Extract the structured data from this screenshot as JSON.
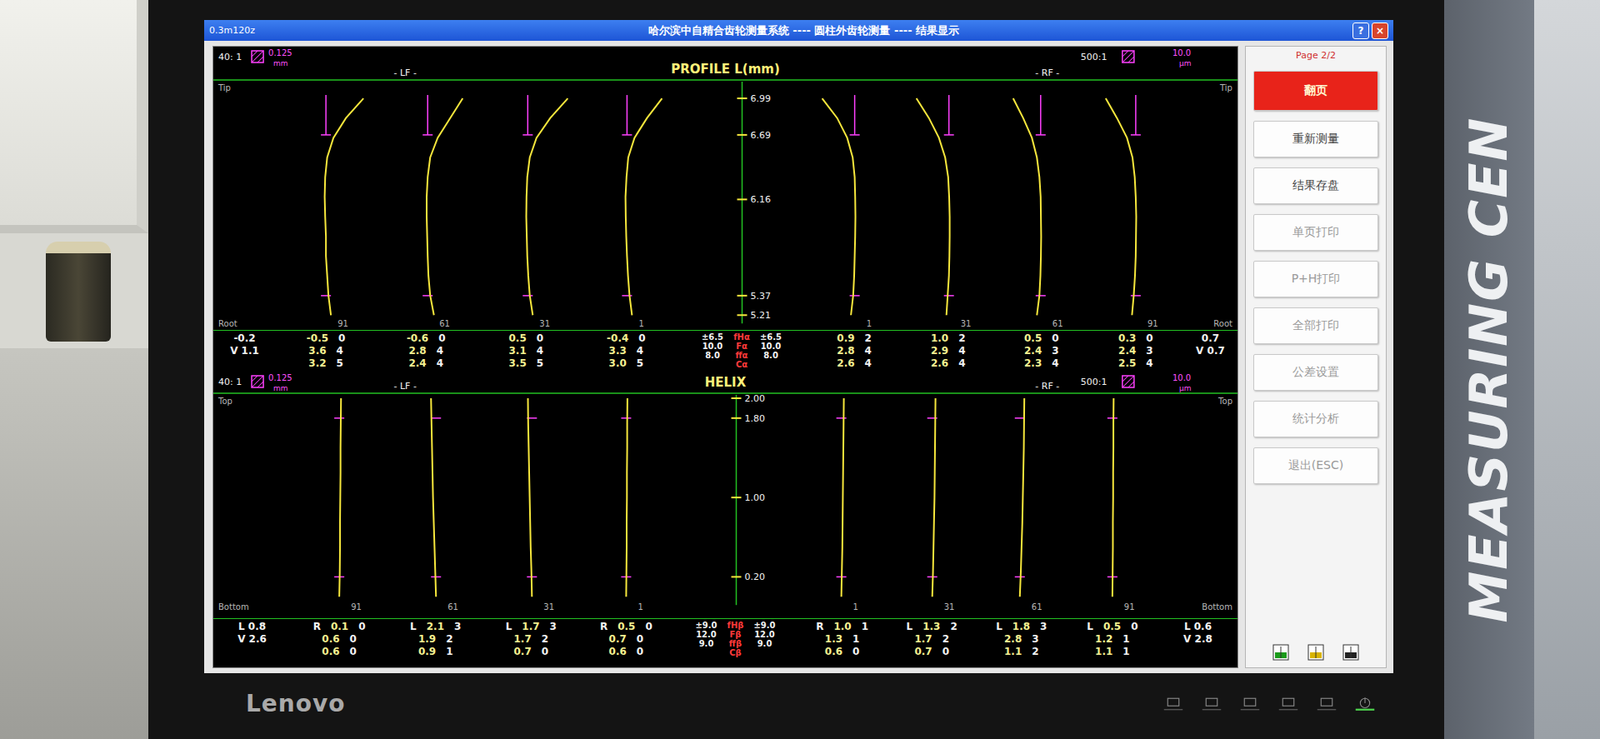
{
  "window": {
    "caption": "0.3m120z",
    "title": "哈尔滨中自精合齿轮测量系统 ---- 圆柱外齿轮测量 ---- 结果显示",
    "buttons": [
      "?",
      "×"
    ]
  },
  "panels": [
    {
      "kind": "profile",
      "scaleLeft": {
        "ratio": "40: 1",
        "value": "0.125",
        "unit": "mm"
      },
      "leftFlank": "- LF -",
      "title": "PROFILE L(mm)",
      "rightFlank": "- RF -",
      "scaleRight": {
        "ratio": "500:1",
        "value": "10.0",
        "unit": "µm"
      },
      "top": {
        "left": "Tip",
        "right": "Tip"
      },
      "bottom": {
        "left": "Root",
        "right": "Root"
      },
      "axis": {
        "min": 5.21,
        "max": 6.99,
        "ticks": [
          "6.99",
          "6.69",
          "6.16",
          "5.37",
          "5.21"
        ]
      },
      "evaluation": {
        "from": 5.37,
        "to": 6.69
      },
      "summaryLeft": [
        "-0.2",
        "V 1.1"
      ],
      "summaryRight": [
        "0.7",
        "V 0.7"
      ],
      "legend": [
        {
          "tolLeft": "±6.5",
          "label": "fHα",
          "tolRight": "±6.5"
        },
        {
          "tolLeft": "10.0",
          "label": "Fα",
          "tolRight": "10.0"
        },
        {
          "tolLeft": "8.0",
          "label": "ffα",
          "tolRight": "8.0"
        },
        {
          "label": "Cα"
        }
      ],
      "left": [
        {
          "tooth": "91",
          "values": [
            2,
            1,
            0.5,
            0,
            0,
            -0.3,
            -0.5,
            -0.3,
            0.5,
            3,
            8,
            15
          ],
          "rows": [
            {
              "value": "-0.5",
              "grade": "0"
            },
            {
              "value": "3.6",
              "grade": "4"
            },
            {
              "value": "3.2",
              "grade": "5"
            }
          ]
        },
        {
          "tooth": "61",
          "values": [
            2.5,
            1,
            0.3,
            0,
            -0.2,
            -0.4,
            -0.4,
            0,
            1,
            4,
            9,
            14
          ],
          "rows": [
            {
              "value": "-0.6",
              "grade": "0"
            },
            {
              "value": "2.8",
              "grade": "4"
            },
            {
              "value": "2.4",
              "grade": "4"
            }
          ]
        },
        {
          "tooth": "31",
          "values": [
            2,
            0.8,
            0.2,
            -0.2,
            -0.4,
            -0.6,
            -0.5,
            -0.2,
            0.8,
            3.5,
            9,
            16
          ],
          "rows": [
            {
              "value": "0.5",
              "grade": "0"
            },
            {
              "value": "3.1",
              "grade": "4"
            },
            {
              "value": "3.5",
              "grade": "5"
            }
          ]
        },
        {
          "tooth": "1",
          "values": [
            2,
            1,
            0.4,
            0,
            -0.3,
            -0.5,
            -0.6,
            -0.2,
            0.5,
            3,
            8,
            14
          ],
          "rows": [
            {
              "value": "-0.4",
              "grade": "0"
            },
            {
              "value": "3.3",
              "grade": "4"
            },
            {
              "value": "3.0",
              "grade": "5"
            }
          ]
        }
      ],
      "right": [
        {
          "tooth": "1",
          "values": [
            1.5,
            0.6,
            0.2,
            0,
            -0.2,
            -0.3,
            -0.2,
            0,
            0.8,
            3,
            7,
            13
          ],
          "rows": [
            {
              "value": "0.9",
              "grade": "2"
            },
            {
              "value": "2.8",
              "grade": "4"
            },
            {
              "value": "2.6",
              "grade": "4"
            }
          ]
        },
        {
          "tooth": "31",
          "values": [
            1,
            0.5,
            0,
            -0.2,
            -0.3,
            -0.3,
            -0.1,
            0.3,
            1.5,
            4,
            8,
            13
          ],
          "rows": [
            {
              "value": "1.0",
              "grade": "2"
            },
            {
              "value": "2.9",
              "grade": "4"
            },
            {
              "value": "2.6",
              "grade": "4"
            }
          ]
        },
        {
          "tooth": "61",
          "values": [
            1.5,
            0.5,
            0.1,
            -0.1,
            -0.2,
            -0.1,
            0,
            0.5,
            1.5,
            3.5,
            7,
            11
          ],
          "rows": [
            {
              "value": "0.5",
              "grade": "0"
            },
            {
              "value": "2.4",
              "grade": "3"
            },
            {
              "value": "2.3",
              "grade": "4"
            }
          ]
        },
        {
          "tooth": "91",
          "values": [
            1.5,
            0.8,
            0.3,
            0,
            -0.1,
            -0.2,
            0,
            0.4,
            1.3,
            3.5,
            7.5,
            12
          ],
          "rows": [
            {
              "value": "0.3",
              "grade": "0"
            },
            {
              "value": "2.4",
              "grade": "3"
            },
            {
              "value": "2.5",
              "grade": "4"
            }
          ]
        }
      ]
    },
    {
      "kind": "helix",
      "scaleLeft": {
        "ratio": "40: 1",
        "value": "0.125",
        "unit": "mm"
      },
      "leftFlank": "- LF -",
      "title": "HELIX",
      "rightFlank": "- RF -",
      "scaleRight": {
        "ratio": "500:1",
        "value": "10.0",
        "unit": "µm"
      },
      "top": {
        "left": "Top",
        "right": "Top"
      },
      "bottom": {
        "left": "Bottom",
        "right": "Bottom"
      },
      "axis": {
        "min": 0,
        "max": 2.0,
        "ticks": [
          "2.00",
          "1.80",
          "1.00",
          "0.20"
        ]
      },
      "evaluation": {
        "from": 0.2,
        "to": 1.8
      },
      "summaryLeft": [
        "L 0.8",
        "V 2.6"
      ],
      "summaryRight": [
        "L 0.6",
        "V 2.8"
      ],
      "legend": [
        {
          "tolLeft": "±9.0",
          "label": "fHβ",
          "tolRight": "±9.0"
        },
        {
          "tolLeft": "12.0",
          "label": "Fβ",
          "tolRight": "12.0"
        },
        {
          "tolLeft": "9.0",
          "label": "ffβ",
          "tolRight": "9.0"
        },
        {
          "label": "Cβ"
        }
      ],
      "left": [
        {
          "tooth": "91",
          "values": [
            0,
            0.2,
            0.3,
            0.3,
            0.4,
            0.5,
            0.5,
            0.6,
            0.7
          ],
          "rows": [
            {
              "dir": "R",
              "value": "0.1",
              "grade": "0"
            },
            {
              "value": "0.6",
              "grade": "0"
            },
            {
              "value": "0.6",
              "grade": "0"
            }
          ]
        },
        {
          "tooth": "61",
          "values": [
            0,
            -0.3,
            -0.6,
            -0.9,
            -1.2,
            -1.4,
            -1.6,
            -1.8,
            -2
          ],
          "rows": [
            {
              "dir": "L",
              "value": "2.1",
              "grade": "3"
            },
            {
              "value": "1.9",
              "grade": "2"
            },
            {
              "value": "0.9",
              "grade": "1"
            }
          ]
        },
        {
          "tooth": "31",
          "values": [
            0,
            -0.2,
            -0.5,
            -0.7,
            -0.9,
            -1.1,
            -1.3,
            -1.5,
            -1.6
          ],
          "rows": [
            {
              "dir": "L",
              "value": "1.7",
              "grade": "3"
            },
            {
              "value": "1.7",
              "grade": "2"
            },
            {
              "value": "0.7",
              "grade": "0"
            }
          ]
        },
        {
          "tooth": "1",
          "values": [
            0,
            0.1,
            0.2,
            0.2,
            0.3,
            0.3,
            0.4,
            0.4,
            0.5
          ],
          "rows": [
            {
              "dir": "R",
              "value": "0.5",
              "grade": "0"
            },
            {
              "value": "0.7",
              "grade": "0"
            },
            {
              "value": "0.6",
              "grade": "0"
            }
          ]
        }
      ],
      "right": [
        {
          "tooth": "1",
          "values": [
            0,
            -0.2,
            -0.4,
            -0.5,
            -0.6,
            -0.7,
            -0.8,
            -0.9,
            -1
          ],
          "rows": [
            {
              "dir": "R",
              "value": "1.0",
              "grade": "1"
            },
            {
              "value": "1.3",
              "grade": "1"
            },
            {
              "value": "0.6",
              "grade": "0"
            }
          ]
        },
        {
          "tooth": "31",
          "values": [
            0,
            -0.3,
            -0.5,
            -0.7,
            -0.9,
            -1,
            -1.1,
            -1.2,
            -1.3
          ],
          "rows": [
            {
              "dir": "L",
              "value": "1.3",
              "grade": "2"
            },
            {
              "value": "1.7",
              "grade": "2"
            },
            {
              "value": "0.7",
              "grade": "0"
            }
          ]
        },
        {
          "tooth": "61",
          "values": [
            0,
            -0.4,
            -0.7,
            -1,
            -1.2,
            -1.4,
            -1.6,
            -1.7,
            -1.8
          ],
          "rows": [
            {
              "dir": "L",
              "value": "1.8",
              "grade": "3"
            },
            {
              "value": "2.8",
              "grade": "3"
            },
            {
              "value": "1.1",
              "grade": "2"
            }
          ]
        },
        {
          "tooth": "91",
          "values": [
            0,
            -0.1,
            -0.2,
            -0.2,
            -0.3,
            -0.3,
            -0.4,
            -0.4,
            -0.5
          ],
          "rows": [
            {
              "dir": "L",
              "value": "0.5",
              "grade": "0"
            },
            {
              "value": "1.2",
              "grade": "1"
            },
            {
              "value": "1.1",
              "grade": "1"
            }
          ]
        }
      ]
    }
  ],
  "sidebar": {
    "page": "Page 2/2",
    "buttons": [
      {
        "label": "翻页",
        "kind": "primary",
        "disabled": false
      },
      {
        "label": "重新测量",
        "kind": "normal",
        "disabled": false
      },
      {
        "label": "结果存盘",
        "kind": "normal",
        "disabled": false
      },
      {
        "label": "单页打印",
        "kind": "normal",
        "disabled": true
      },
      {
        "label": "P+H打印",
        "kind": "normal",
        "disabled": true
      },
      {
        "label": "全部打印",
        "kind": "normal",
        "disabled": true
      },
      {
        "label": "公差设置",
        "kind": "normal",
        "disabled": true
      },
      {
        "label": "统计分析",
        "kind": "normal",
        "disabled": true
      },
      {
        "label": "退出(ESC)",
        "kind": "normal",
        "disabled": true
      }
    ]
  },
  "monitor": {
    "brand": "Lenovo"
  },
  "background": {
    "sign": "MEASURING CEN"
  }
}
